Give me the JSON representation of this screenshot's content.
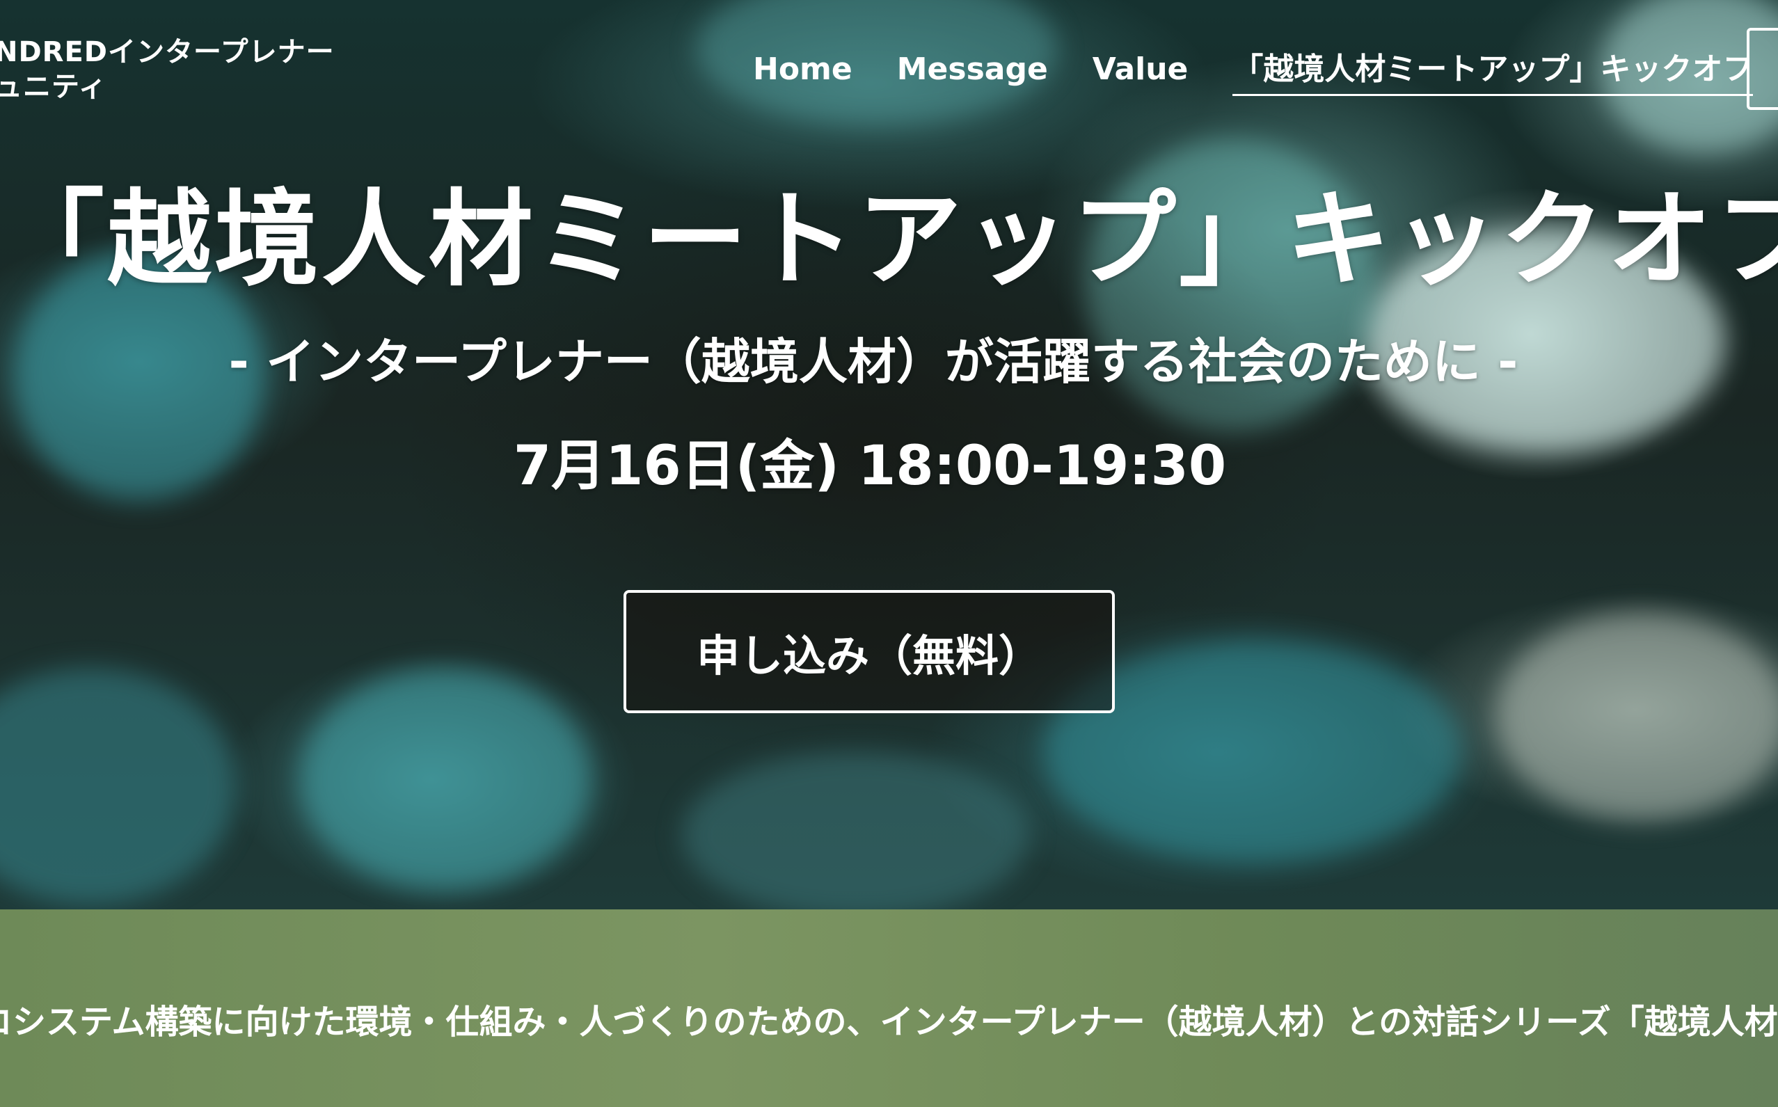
{
  "header": {
    "brand_line1": "NDREDインタープレナー",
    "brand_line2": "ュニティ"
  },
  "nav": {
    "items": [
      {
        "label": "Home"
      },
      {
        "label": "Message"
      },
      {
        "label": "Value"
      },
      {
        "label": "「越境人材ミートアップ」キックオフ",
        "active": true
      }
    ]
  },
  "hero": {
    "title": "「越境人材ミートアップ」キックオフ",
    "subtitle": "- インタープレナー（越境人材）が活躍する社会のために -",
    "date": "7月16日(金) 18:00-19:30",
    "apply_label": "申し込み（無料）"
  },
  "intro": {
    "text": "コシステム構築に向けた環境・仕組み・人づくりのための、インタープレナー（越境人材）との対話シリーズ「越境人材"
  }
}
